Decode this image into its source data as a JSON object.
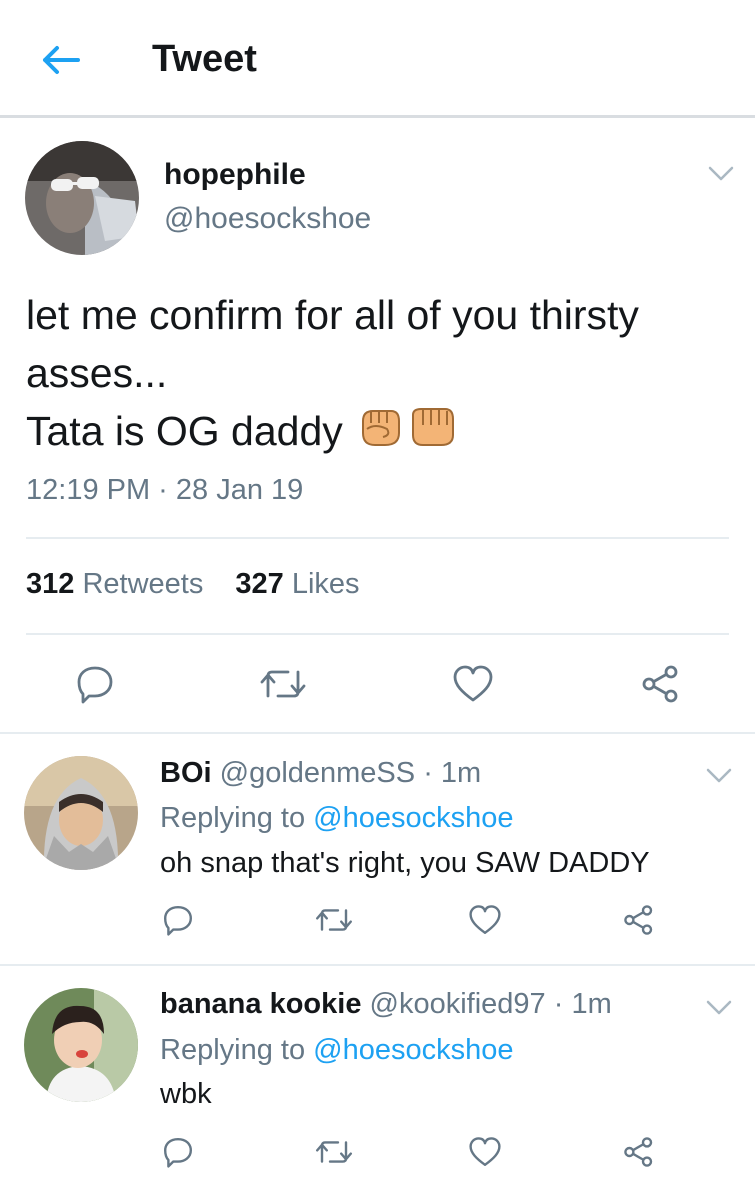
{
  "header": {
    "title": "Tweet"
  },
  "tweet": {
    "name": "hopephile",
    "handle": "@hoesockshoe",
    "text_line1": "let me confirm for all of you thirsty",
    "text_line2": "asses...",
    "text_line3": "Tata is OG daddy",
    "time": "12:19 PM · 28 Jan 19",
    "retweets_count": "312",
    "retweets_label": "Retweets",
    "likes_count": "327",
    "likes_label": "Likes"
  },
  "replies": [
    {
      "name": "BOi",
      "handle": "@goldenmeSS",
      "time": "· 1m",
      "replying_label": "Replying to",
      "replying_to": "@hoesockshoe",
      "text": "oh snap that's right, you SAW DADDY"
    },
    {
      "name": "banana kookie",
      "handle": "@kookified97",
      "time": "· 1m",
      "replying_label": "Replying to",
      "replying_to": "@hoesockshoe",
      "text": "wbk"
    }
  ],
  "colors": {
    "accent": "#1da1f2",
    "secondary_text": "#657786",
    "divider": "#e6ecf0"
  }
}
